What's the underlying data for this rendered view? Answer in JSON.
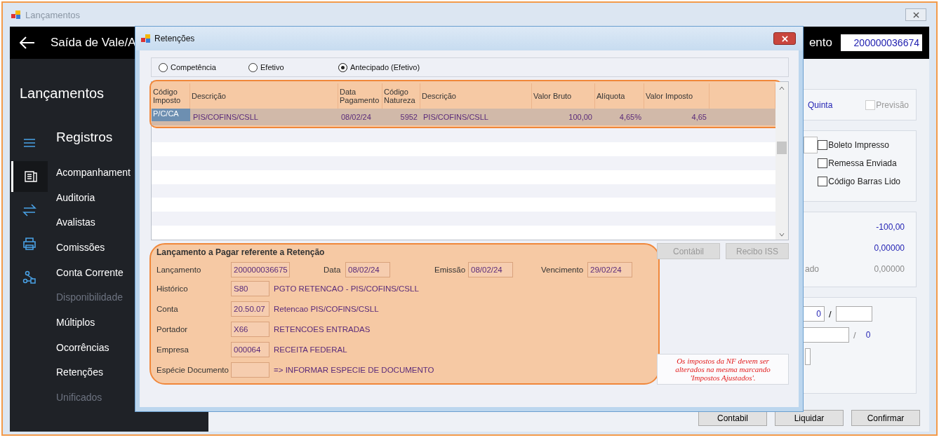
{
  "window": {
    "title": "Lançamentos"
  },
  "header": {
    "title": "Saída de Vale/A",
    "field_label": "ento",
    "field_value": "200000036674"
  },
  "sidebar": {
    "title": "Lançamentos",
    "section": "Registros",
    "icons": [
      {
        "kind": "menu",
        "selected": false
      },
      {
        "kind": "document",
        "selected": true
      },
      {
        "kind": "transfer",
        "selected": false
      },
      {
        "kind": "printer",
        "selected": false
      },
      {
        "kind": "network",
        "selected": false
      }
    ],
    "items": [
      {
        "label": "Acompanhament",
        "disabled": false
      },
      {
        "label": "Auditoria",
        "disabled": false
      },
      {
        "label": "Avalistas",
        "disabled": false
      },
      {
        "label": "Comissões",
        "disabled": false
      },
      {
        "label": "Conta Corrente",
        "disabled": false
      },
      {
        "label": "Disponibilidade",
        "disabled": true
      },
      {
        "label": "Múltiplos",
        "disabled": false
      },
      {
        "label": "Ocorrências",
        "disabled": false
      },
      {
        "label": "Retenções",
        "disabled": false
      },
      {
        "label": "Unificados",
        "disabled": true
      }
    ]
  },
  "right_panel": {
    "weekday": "Quinta",
    "forecast": {
      "label": "Previsão",
      "checked": false,
      "disabled": true
    },
    "checkboxes": [
      {
        "label": "Boleto Impresso",
        "checked": false
      },
      {
        "label": "Remessa Enviada",
        "checked": false
      },
      {
        "label": "Código Barras Lido",
        "checked": false
      }
    ],
    "values": [
      {
        "value": "-100,00",
        "muted": false
      },
      {
        "value": "0,00000",
        "muted": false
      },
      {
        "label": "ado",
        "value": "0,00000",
        "muted": true
      }
    ],
    "installment": {
      "value": "0",
      "separator": "/"
    },
    "count": {
      "separator": "/",
      "value": "0"
    },
    "buttons": [
      {
        "label": "Contabil"
      },
      {
        "label": "Liquidar"
      },
      {
        "label": "Confirmar"
      }
    ]
  },
  "dialog": {
    "title": "Retenções",
    "modes": [
      {
        "label": "Competência",
        "selected": false
      },
      {
        "label": "Efetivo",
        "selected": false
      },
      {
        "label": "Antecipado (Efetivo)",
        "selected": true
      }
    ],
    "table": {
      "columns": [
        "Código Imposto",
        "Descrição",
        "Data Pagamento",
        "Código Natureza",
        "Descrição",
        "Valor Bruto",
        "Alíquota",
        "Valor Imposto"
      ],
      "rows": [
        {
          "selected": true,
          "cells": [
            "P/C/CA",
            "PIS/COFINS/CSLL",
            "08/02/24",
            "5952",
            "PIS/COFINS/CSLL",
            "100,00",
            "4,65%",
            "4,65"
          ]
        }
      ]
    },
    "form": {
      "title": "Lançamento a Pagar referente a Retenção",
      "top_fields": [
        {
          "label": "Lançamento",
          "value": "200000036675"
        },
        {
          "label": "Data",
          "value": "08/02/24"
        },
        {
          "label": "Emissão",
          "value": "08/02/24"
        },
        {
          "label": "Vencimento",
          "value": "29/02/24"
        }
      ],
      "rows": [
        {
          "label": "Histórico",
          "code": "S80",
          "description": "PGTO RETENCAO - PIS/COFINS/CSLL"
        },
        {
          "label": "Conta",
          "code": "20.50.07",
          "description": "Retencao PIS/COFINS/CSLL"
        },
        {
          "label": "Portador",
          "code": "X66",
          "description": "RETENCOES ENTRADAS"
        },
        {
          "label": "Empresa",
          "code": "000064",
          "description": "RECEITA FEDERAL"
        },
        {
          "label": "Espécie Documento",
          "code": "",
          "description": "=> INFORMAR ESPECIE DE DOCUMENTO"
        }
      ]
    },
    "buttons": [
      {
        "label": "Contábil",
        "disabled": true
      },
      {
        "label": "Recibo ISS",
        "disabled": true
      }
    ],
    "note": "Os impostos da NF devem ser alterados na mesma marcando 'Impostos Ajustados'."
  }
}
